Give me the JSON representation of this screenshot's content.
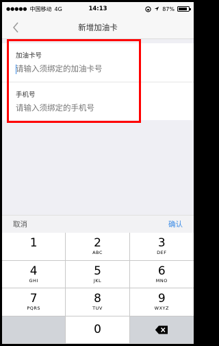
{
  "status_bar": {
    "carrier": "中国移动",
    "network": "4G",
    "time": "14:13",
    "battery": "87%",
    "battery_level": 0.87
  },
  "nav": {
    "title": "新增加油卡",
    "back_icon": "chevron-left-icon"
  },
  "form": {
    "card_label": "加油卡号",
    "card_placeholder": "请输入须绑定的加油卡号",
    "phone_label": "手机号",
    "phone_placeholder": "请输入须绑定的手机号"
  },
  "keyboard_toolbar": {
    "cancel": "取消",
    "confirm": "确认"
  },
  "keypad": {
    "keys": [
      {
        "num": "1",
        "letters": ""
      },
      {
        "num": "2",
        "letters": "ABC"
      },
      {
        "num": "3",
        "letters": "DEF"
      },
      {
        "num": "4",
        "letters": "GHI"
      },
      {
        "num": "5",
        "letters": "JKL"
      },
      {
        "num": "6",
        "letters": "MNO"
      },
      {
        "num": "7",
        "letters": "PQRS"
      },
      {
        "num": "8",
        "letters": "TUV"
      },
      {
        "num": "9",
        "letters": "WXYZ"
      },
      {
        "num": "0",
        "letters": ""
      }
    ]
  },
  "colors": {
    "accent": "#3c8ce6",
    "highlight": "#ff0000"
  }
}
